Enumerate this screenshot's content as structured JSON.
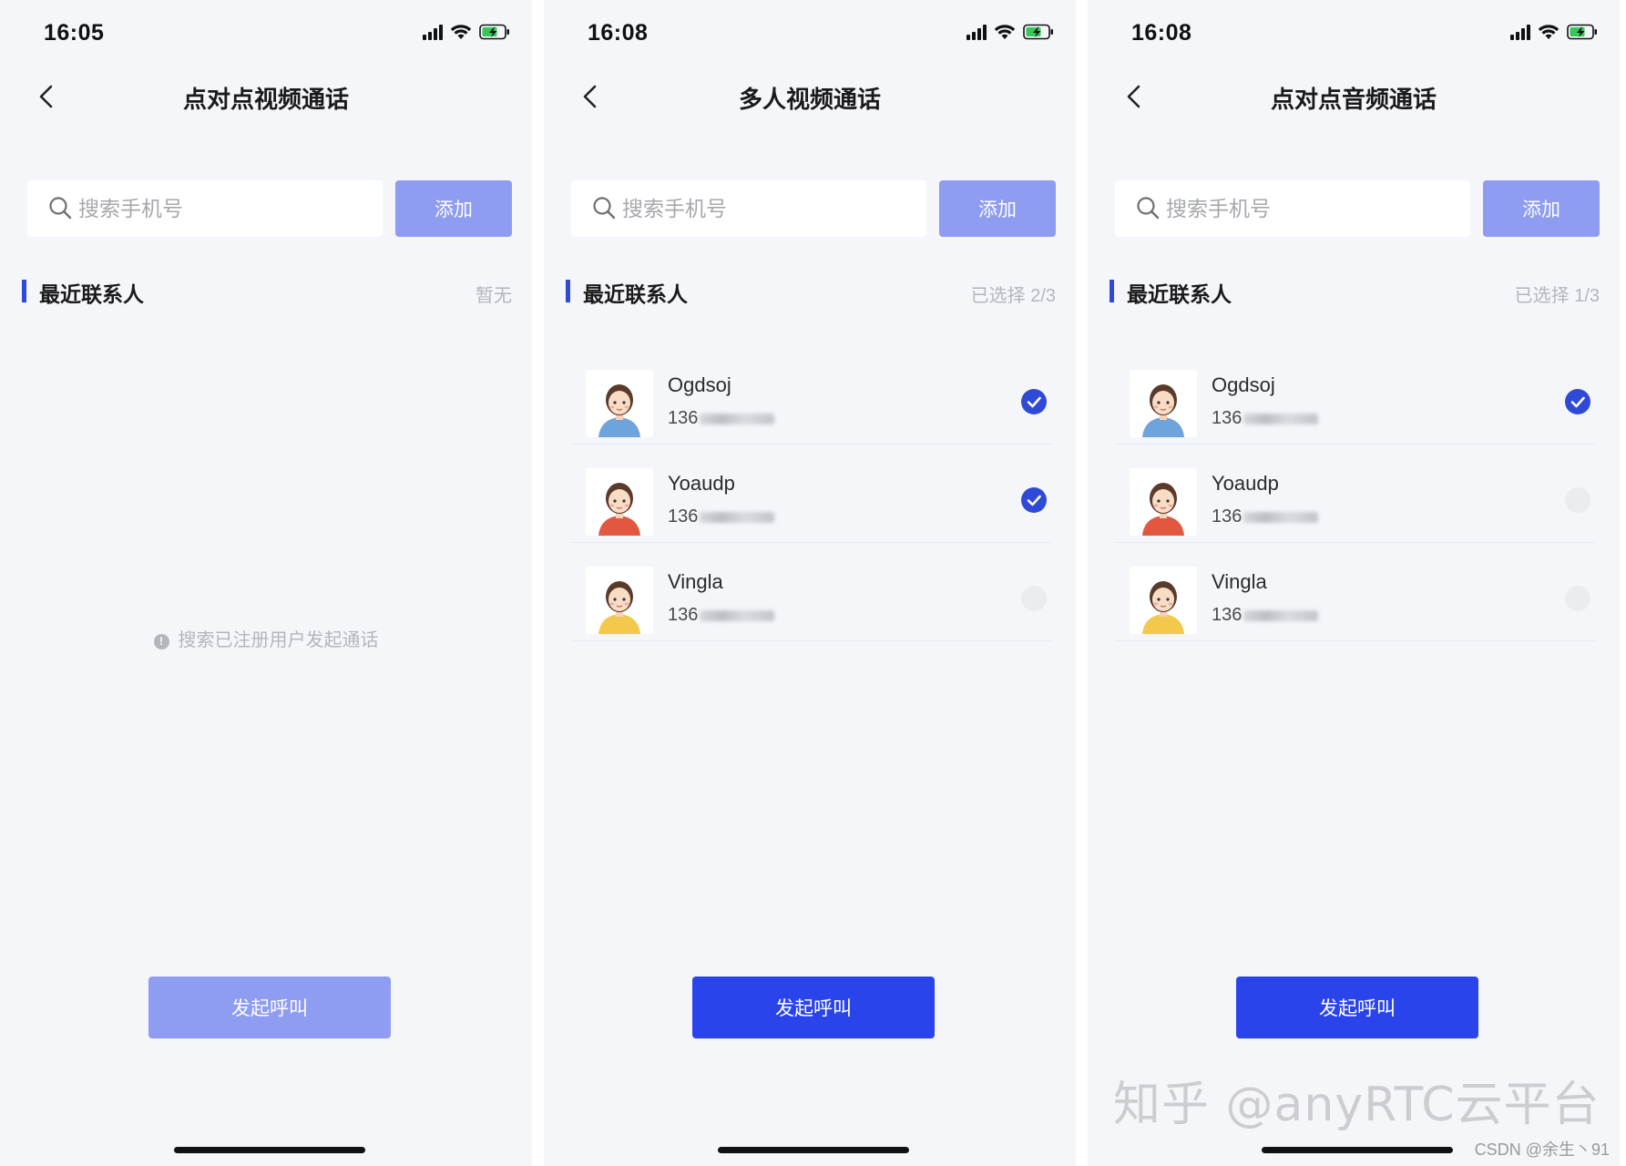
{
  "screens": [
    {
      "status": {
        "time": "16:05"
      },
      "title": "点对点视频通话",
      "search": {
        "placeholder": "搜索手机号",
        "add_label": "添加"
      },
      "section": {
        "title": "最近联系人",
        "count": "暂无"
      },
      "hint": "搜索已注册用户发起通话",
      "call_label": "发起呼叫",
      "call_state": "disabled",
      "contacts": []
    },
    {
      "status": {
        "time": "16:08"
      },
      "title": "多人视频通话",
      "search": {
        "placeholder": "搜索手机号",
        "add_label": "添加"
      },
      "section": {
        "title": "最近联系人",
        "count": "已选择 2/3"
      },
      "call_label": "发起呼叫",
      "call_state": "active",
      "contacts": [
        {
          "name": "Ogdsoj",
          "phone_prefix": "136",
          "selected": true,
          "avatar": "girl-blue-shirt-avatar"
        },
        {
          "name": "Yoaudp",
          "phone_prefix": "136",
          "selected": true,
          "avatar": "girl-red-shirt-avatar"
        },
        {
          "name": "Vingla",
          "phone_prefix": "136",
          "selected": false,
          "avatar": "girl-yellow-shirt-avatar"
        }
      ]
    },
    {
      "status": {
        "time": "16:08"
      },
      "title": "点对点音频通话",
      "search": {
        "placeholder": "搜索手机号",
        "add_label": "添加"
      },
      "section": {
        "title": "最近联系人",
        "count": "已选择 1/3"
      },
      "call_label": "发起呼叫",
      "call_state": "active",
      "contacts": [
        {
          "name": "Ogdsoj",
          "phone_prefix": "136",
          "selected": true,
          "avatar": "girl-blue-shirt-avatar"
        },
        {
          "name": "Yoaudp",
          "phone_prefix": "136",
          "selected": false,
          "avatar": "girl-red-shirt-avatar"
        },
        {
          "name": "Vingla",
          "phone_prefix": "136",
          "selected": false,
          "avatar": "girl-yellow-shirt-avatar"
        }
      ]
    }
  ],
  "watermark": "知乎 @anyRTC云平台",
  "credit": "CSDN @余生丶91",
  "colors": {
    "accent": "#2a44ec",
    "accent_disabled": "#8e9cf2",
    "check_on": "#2f4ad6",
    "background": "#f5f6fa"
  }
}
